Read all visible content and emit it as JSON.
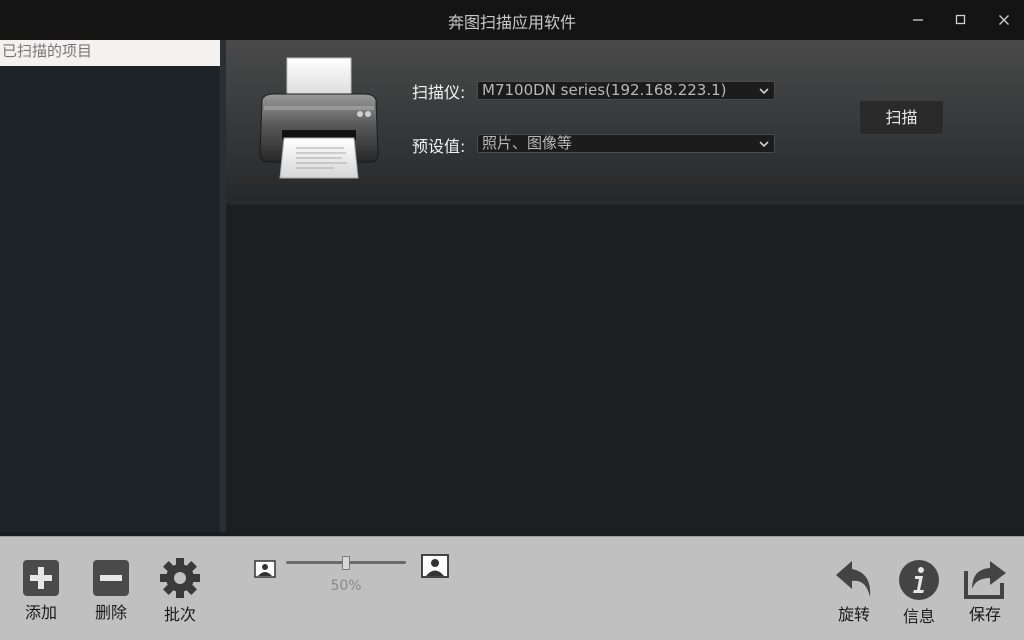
{
  "window": {
    "title": "奔图扫描应用软件",
    "controls": [
      "minimize-icon",
      "maximize-icon",
      "close-icon"
    ]
  },
  "sidebar": {
    "header": "已扫描的项目",
    "items": []
  },
  "scan_panel": {
    "scanner_label": "扫描仪:",
    "scanner_value": "M7100DN series(192.168.223.1)",
    "preset_label": "预设值:",
    "preset_value": "照片、图像等",
    "scan_button": "扫描",
    "device_icon": "printer-icon"
  },
  "toolbar": {
    "add_label": "添加",
    "delete_label": "删除",
    "batch_label": "批次",
    "zoom_label": "50%",
    "zoom_level": 0.5,
    "rotate_label": "旋转",
    "info_label": "信息",
    "save_label": "保存"
  },
  "colors": {
    "titlebar": "#141414",
    "sidebar_bg": "#1e2327",
    "content_bg": "#1c1f22",
    "bottombar_bg": "#c0c0c0"
  }
}
